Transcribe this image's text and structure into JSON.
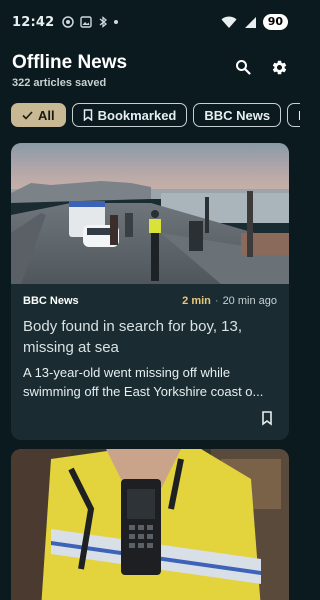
{
  "status_bar": {
    "time": "12:42",
    "battery": "90"
  },
  "header": {
    "title": "Offline News",
    "subtitle": "322 articles saved"
  },
  "chips": [
    {
      "label": "All",
      "selected": true,
      "icon": "check-icon"
    },
    {
      "label": "Bookmarked",
      "selected": false,
      "icon": "bookmark-icon"
    },
    {
      "label": "BBC News",
      "selected": false,
      "icon": ""
    },
    {
      "label": "NO",
      "selected": false,
      "icon": ""
    }
  ],
  "articles": [
    {
      "source": "BBC News",
      "read_time": "2 min",
      "separator": "·",
      "age": "20 min ago",
      "title": "Body found in search for boy, 13, missing at sea",
      "summary_line1": "A 13-year-old went missing off while",
      "summary_line2": "swimming off the East Yorkshire coast o..."
    }
  ],
  "colors": {
    "background": "#0b1a1e",
    "card": "#1a2c31",
    "chip_selected": "#c8b894",
    "read_time": "#e8c77a"
  }
}
